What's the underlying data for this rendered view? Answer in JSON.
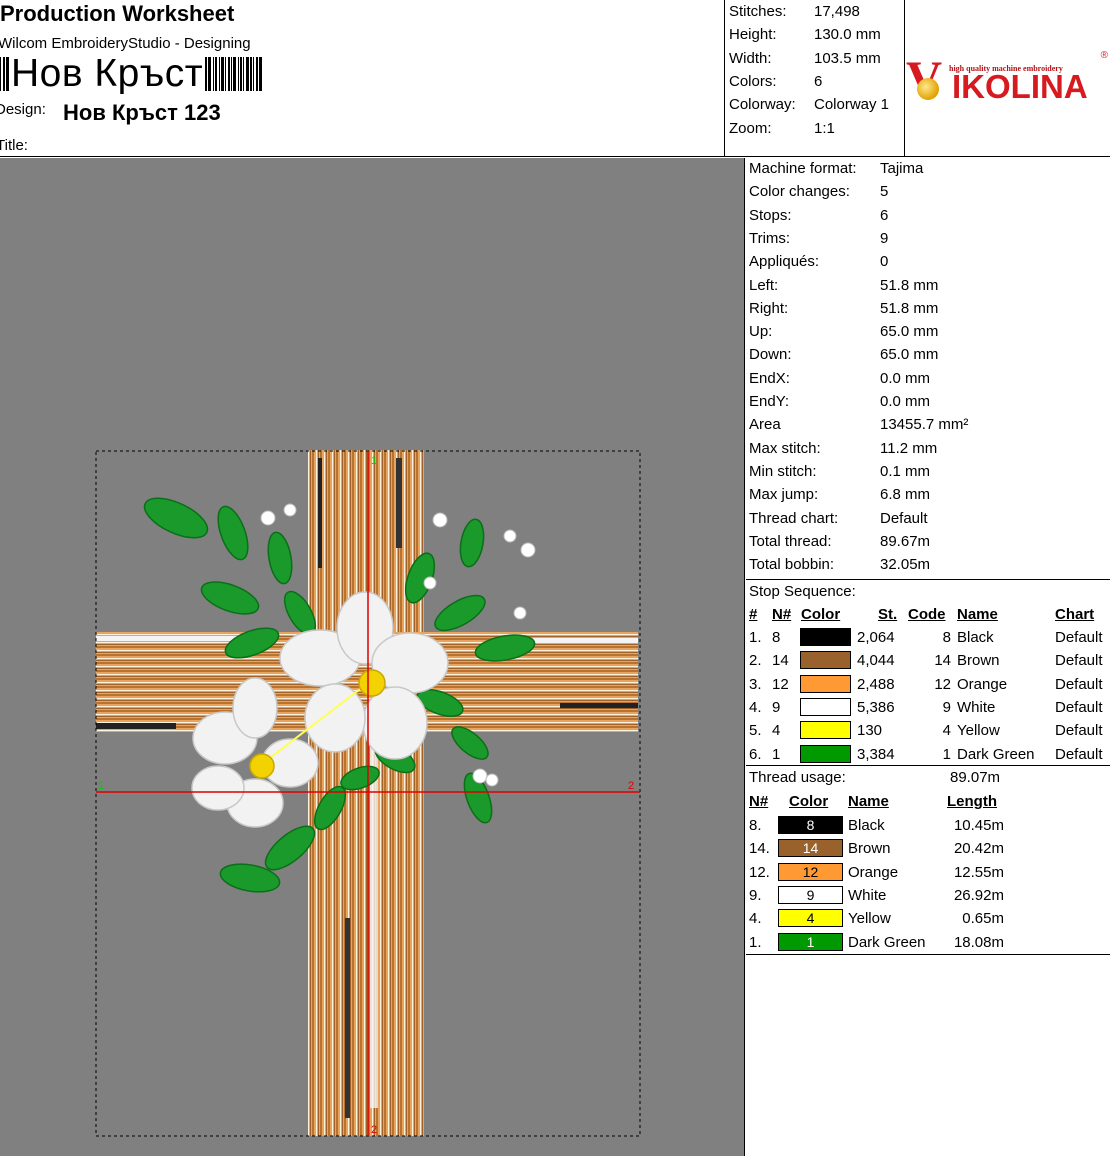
{
  "header": {
    "title": "Production Worksheet",
    "subtitle": "Wilcom EmbroideryStudio - Designing",
    "barcode_text": "Нов Кръст",
    "design_label": "Design:",
    "design_name": "Нов Кръст 123",
    "title_label": "Title:"
  },
  "header_stats": [
    {
      "label": "Stitches:",
      "value": "17,498"
    },
    {
      "label": "Height:",
      "value": "130.0 mm"
    },
    {
      "label": "Width:",
      "value": "103.5 mm"
    },
    {
      "label": "Colors:",
      "value": "6"
    },
    {
      "label": "Colorway:",
      "value": "Colorway 1"
    },
    {
      "label": "Zoom:",
      "value": "1:1"
    }
  ],
  "logo": {
    "letter": "V",
    "word": "IKOLINA",
    "tagline": "high quality machine embroidery",
    "registered": "®",
    "colors": {
      "red": "#d71920",
      "gold": "#e0a100"
    }
  },
  "design_markers": {
    "left": "1",
    "right": "2",
    "top": "1",
    "bottom": "2"
  },
  "stats": [
    {
      "label": "Machine format:",
      "value": "Tajima"
    },
    {
      "label": "Color changes:",
      "value": "5"
    },
    {
      "label": "Stops:",
      "value": "6"
    },
    {
      "label": "Trims:",
      "value": "9"
    },
    {
      "label": "Appliqués:",
      "value": "0"
    },
    {
      "label": "Left:",
      "value": "51.8 mm"
    },
    {
      "label": "Right:",
      "value": "51.8 mm"
    },
    {
      "label": "Up:",
      "value": "65.0 mm"
    },
    {
      "label": "Down:",
      "value": "65.0 mm"
    },
    {
      "label": "EndX:",
      "value": "0.0 mm"
    },
    {
      "label": "EndY:",
      "value": "0.0 mm"
    },
    {
      "label": "Area",
      "value": "13455.7 mm²"
    },
    {
      "label": "Max stitch:",
      "value": "11.2 mm"
    },
    {
      "label": "Min stitch:",
      "value": "0.1 mm"
    },
    {
      "label": "Max jump:",
      "value": "6.8 mm"
    },
    {
      "label": "Thread chart:",
      "value": "Default"
    },
    {
      "label": "Total thread:",
      "value": "89.67m"
    },
    {
      "label": "Total bobbin:",
      "value": "32.05m"
    }
  ],
  "stop_sequence": {
    "title": "Stop Sequence:",
    "headers": {
      "index": "#",
      "needle": "N#",
      "color": "Color",
      "stitches": "St.",
      "code": "Code",
      "name": "Name",
      "chart": "Chart"
    },
    "rows": [
      {
        "index": "1.",
        "needle": "8",
        "color": "#000000",
        "stitches": "2,064",
        "code": "8",
        "name": "Black",
        "chart": "Default"
      },
      {
        "index": "2.",
        "needle": "14",
        "color": "#99612c",
        "stitches": "4,044",
        "code": "14",
        "name": "Brown",
        "chart": "Default"
      },
      {
        "index": "3.",
        "needle": "12",
        "color": "#ff9933",
        "stitches": "2,488",
        "code": "12",
        "name": "Orange",
        "chart": "Default"
      },
      {
        "index": "4.",
        "needle": "9",
        "color": "#ffffff",
        "stitches": "5,386",
        "code": "9",
        "name": "White",
        "chart": "Default"
      },
      {
        "index": "5.",
        "needle": "4",
        "color": "#ffff00",
        "stitches": "130",
        "code": "4",
        "name": "Yellow",
        "chart": "Default"
      },
      {
        "index": "6.",
        "needle": "1",
        "color": "#009900",
        "stitches": "3,384",
        "code": "1",
        "name": "Dark Green",
        "chart": "Default"
      }
    ]
  },
  "thread_usage": {
    "title": "Thread usage:",
    "total": "89.07m",
    "headers": {
      "needle": "N#",
      "color": "Color",
      "name": "Name",
      "length": "Length"
    },
    "rows": [
      {
        "needle": "8.",
        "code": "8",
        "color": "#000000",
        "text_color": "#ffffff",
        "name": "Black",
        "length": "10.45m"
      },
      {
        "needle": "14.",
        "code": "14",
        "color": "#99612c",
        "text_color": "#ffffff",
        "name": "Brown",
        "length": "20.42m"
      },
      {
        "needle": "12.",
        "code": "12",
        "color": "#ff9933",
        "text_color": "#000000",
        "name": "Orange",
        "length": "12.55m"
      },
      {
        "needle": "9.",
        "code": "9",
        "color": "#ffffff",
        "text_color": "#000000",
        "name": "White",
        "length": "26.92m"
      },
      {
        "needle": "4.",
        "code": "4",
        "color": "#ffff00",
        "text_color": "#000000",
        "name": "Yellow",
        "length": "0.65m"
      },
      {
        "needle": "1.",
        "code": "1",
        "color": "#009900",
        "text_color": "#ffffff",
        "name": "Dark Green",
        "length": "18.08m"
      }
    ]
  }
}
